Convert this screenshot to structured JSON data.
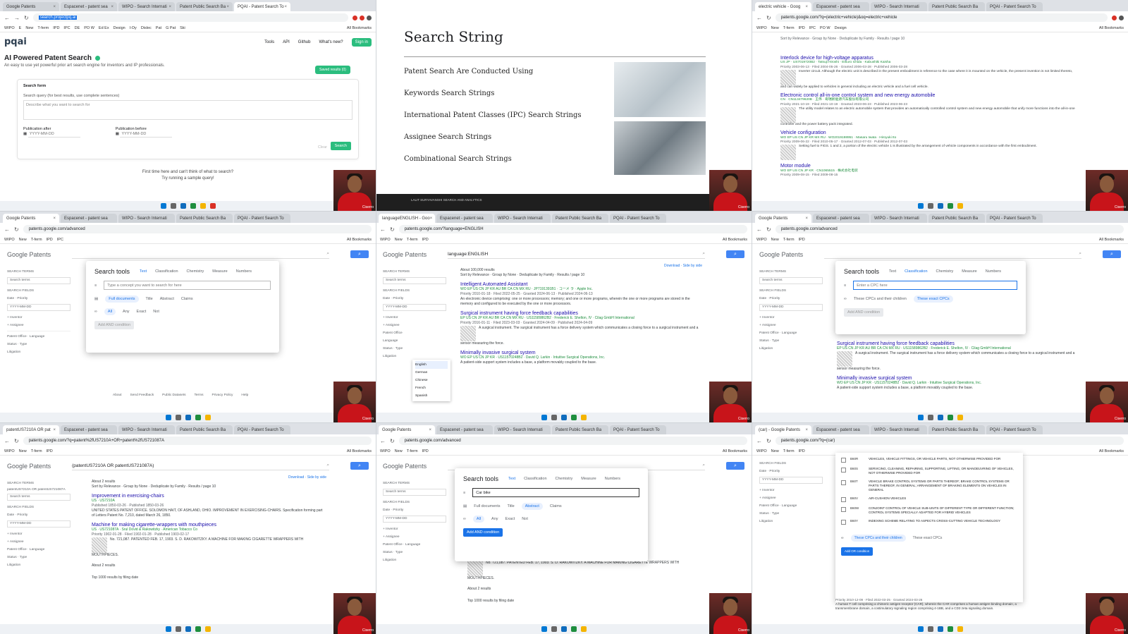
{
  "tabs": [
    "Google Patents",
    "Espacenet - patent sea",
    "WIPO - Search Internati",
    "Patent Public Search Ba",
    "PQAI - Patent Search To"
  ],
  "tabs_alt": [
    "languageENGLISH - Goo",
    "Espacenet - patent sea",
    "WIPO - Search Internati",
    "Patent Public Search Ba",
    "PQAI - Patent Search To"
  ],
  "tabs_tr": [
    "electric vehicle - Goog",
    "Espacenet - patent sea",
    "WIPO - Search Internati",
    "Patent Public Search Ba",
    "PQAI - Patent Search To"
  ],
  "tabs_bl": [
    "patentUS7210A OR pat",
    "Espacenet - patent sea",
    "WIPO - Search Internati",
    "Patent Public Search Ba",
    "PQAI - Patent Search To"
  ],
  "tabs_br": [
    "(car) - Google Patents",
    "Espacenet - patent sea",
    "WIPO - Search Internati",
    "Patent Public Search Ba",
    "PQAI - Patent Search To"
  ],
  "bookmarks": [
    "WIPO",
    "E",
    "New",
    "T-ferm",
    "IPD",
    "IPC",
    "DE",
    "PO W",
    "Ed Ex",
    "Design",
    "I-Dy",
    "Dislec",
    "Pat",
    "G Pat",
    "Ski",
    "All Bookmarks"
  ],
  "urls": {
    "pqai": "search.projectpq.ai",
    "tr": "patents.google.com/?q=(electric+vehicle)&oq=electric+vehicle",
    "advanced": "patents.google.com/advanced",
    "lang": "patents.google.com/?language=ENGLISH",
    "bl": "patents.google.com/?q=patent%2fUS7210A+OR+patent%2fUS721087A",
    "br": "patents.google.com/?q=(car)"
  },
  "pqai": {
    "logo": "pqai",
    "nav": [
      "Tools",
      "API",
      "Github",
      "What's new?"
    ],
    "sign_in": "Sign in",
    "title": "AI Powered Patent Search",
    "subtitle": "An easy to use yet powerful prior art search engine for inventors and IP professionals.",
    "saved": "Saved results (0)",
    "form_title": "Search form",
    "query_label": "Search query (for best results, use complete sentences)",
    "query_placeholder": "Describe what you want to search for",
    "after_label": "Publication after",
    "before_label": "Publication before",
    "date_placeholder": "YYYY-MM-DD",
    "clear": "Clear",
    "search": "Search",
    "foot1": "First time here and can't think of what to search?",
    "foot2": "Try running a sample query!"
  },
  "slide": {
    "title": "Search String",
    "items": [
      "Patent Search Are Conducted Using",
      "Keywords Search Strings",
      "International Patent Classes (IPC) Search Strings",
      "Assignee Search Strings",
      "Combinational Search Strings"
    ],
    "footer": "LALIT SURYAVANSHI SEARCH AND ANALYTICS"
  },
  "gp": {
    "logo_a": "Google",
    "logo_b": "Patents",
    "search_terms": "SEARCH TERMS",
    "search_terms_ph": "Search terms",
    "search_fields": "SEARCH FIELDS",
    "date": "Date",
    "priority": "Priority",
    "date_ph": "YYYY-MM-DD",
    "inventor": "+ Inventor",
    "assignee": "+ Assignee",
    "patent_office": "Patent Office",
    "language": "Language",
    "status": "Status",
    "type": "Type",
    "litigation": "Litigation",
    "download": "Download",
    "side_by_side": "Side by side",
    "sortbar": "Sort by Relevance · Group by None · Deduplicate by Family · Results / page 10",
    "footer_links": [
      "About",
      "Send Feedback",
      "Public Datasets",
      "Terms",
      "Privacy Policy",
      "Help"
    ]
  },
  "modal": {
    "title": "Search tools",
    "tabs": [
      "Text",
      "Classification",
      "Chemistry",
      "Measure",
      "Numbers"
    ],
    "concept_ph": "Type a concept you want to search for here",
    "scopes": [
      "Full documents",
      "Title",
      "Abstract",
      "Claims"
    ],
    "logic": [
      "All",
      "Any",
      "Exact",
      "Not"
    ],
    "add_and": "Add AND condition",
    "add_or": "Add OR condition",
    "cpc_ph": "Enter a CPC here",
    "cpc_children": "These CPCs and their children",
    "cpc_exact": "These exact CPCs",
    "car_value": "Car bike"
  },
  "tr_results": [
    {
      "title": "Interlock device for high-voltage apparatus",
      "meta": "US JP · US7019720B2 · Tatsuji Hiroshi · Etsuro Ichida · Kabushiki Kaisha",
      "dates": "Priority 2003-06-13 · Filed 2004-05-26 · Granted 2006-03-28 · Published 2006-03-28",
      "snippet": "Inverter circuit. Although the electric unit is described in the present embodiment in reference to the case where it is mounted on the vehicle, the present invention is not limited thereto, and can widely be applied to vehicles in general including an electric vehicle and a fuel cell vehicle."
    },
    {
      "title": "Electronic control all-in-one control system and new energy automobile",
      "meta": "CN · CN113479620B · 王伟 · 奇瑞新能源汽车股份有限公司",
      "dates": "Priority 2021-10-19 · Filed 2021-10-19 · Granted 2023-06-23 · Published 2023-06-23",
      "snippet": "The utility model relates to an electric automobile system that provides an automatically controlled control system and new energy automobile that unify more functions into the all-in-one controller and the power battery pack integrated."
    },
    {
      "title": "Vehicle configuration",
      "meta": "WO EP US CN JP KR MX RU · WO2019198951 · Masaru Iwata · Hiroyuki Ito",
      "dates": "Priority 2009-06-22 · Filed 2010-05-17 · Granted 2012-07-03 · Published 2012-07-03",
      "snippet": "Setting fuel to FIGS. 1 and 2, a portion of the electric vehicle 1 is illustrated by the arrangement of vehicle components in accordance with the first embodiment."
    },
    {
      "title": "Motor module",
      "meta": "WO EP US CN JP KR · CN1065515 · 株式会社电装",
      "dates": "Priority 2009-08-15 · Filed 2009-08-15",
      "snippet": ""
    }
  ],
  "lang_results": {
    "count": "About 100,000 results",
    "items": [
      {
        "title": "Intelligent Automated Assistant",
        "meta": "WO EP US CN JP KR AU BR CA CN MX RU · JP7191391B1 · コーメ ラ · Apple Inc.",
        "dates": "Priority 2010-01-18 · Filed 2022-05-25 · Granted 2024-06-13 · Published 2024-06-13",
        "snippet": "An electronic device comprising: one or more processors; memory; and one or more programs, wherein the one or more programs are stored in the memory and configured to be executed by the one or more processors."
      },
      {
        "title": "Surgical instrument having force feedback capabilities",
        "meta": "EP US CN JP KR AU BR CA CN MX RU · US11589862B2 · Frederick E. Shelton, IV · Cilag GmbH International",
        "dates": "Priority 2016-01-11 · Filed 2023-03-03 · Granted 2024-04-09 · Published 2024-04-09",
        "snippet": "A surgical instrument. The surgical instrument has a force delivery system which communicates a closing force to a surgical instrument and a sensor measuring the force."
      },
      {
        "title": "Minimally invasive surgical system",
        "meta": "WO EP US CN JP KR · US11570248B2 · David Q. Larkin · Intuitive Surgical Operations, Inc.",
        "dates": "",
        "snippet": "A patient-side support system includes a base, a platform movably coupled to the base."
      }
    ],
    "languages": [
      "English",
      "German",
      "Chinese",
      "French",
      "Spanish"
    ]
  },
  "bl_results": {
    "query": "(patentUS7210A OR patentUS721087A)",
    "count": "About 2 results",
    "terms": "patentUS7210A OR patentUS721087A",
    "items": [
      {
        "title": "Improvement in exercising-chairs",
        "meta": "US · US7210A",
        "dates": "Published 1850-03-26 · Published 1850-03-26",
        "snippet": "UNITED STATES PATENT OFFICE. SOLOMON HAIT, OF ASHLAND, OHIO. IMPROVEMENT IN EXERCISING-CHAIRS. Specification forming part of Letters Patent No. 7,210, dated March 26, 1850."
      },
      {
        "title": "Machine for making cigarette-wrappers with mouthpieces",
        "meta": "US · US721087A · Srul Dovid & Rakowitzky · American Tobacco Co",
        "dates": "Priority 1902-01-28 · Filed 1902-01-28 · Published 1903-02-17",
        "snippet": "No. 721,087. PATENTED FEB. 17, 1903. S. D. RAKOWITZKY. A MACHINE FOR MAKING CIGARETTE WRAPPERS WITH MOUTHPIECES."
      }
    ],
    "footer": "Top 1000 results by filing date"
  },
  "cpc_list": [
    {
      "code": "B60R",
      "text": "VEHICLES, VEHICLE FITTINGS, OR VEHICLE PARTS, NOT OTHERWISE PROVIDED FOR"
    },
    {
      "code": "B60S",
      "text": "SERVICING, CLEANING, REPAIRING, SUPPORTING, LIFTING, OR MANOEUVRING OF VEHICLES, NOT OTHERWISE PROVIDED FOR"
    },
    {
      "code": "B60T",
      "text": "VEHICLE BRAKE CONTROL SYSTEMS OR PARTS THEREOF; BRAKE CONTROL SYSTEMS OR PARTS THEREOF, IN GENERAL; ARRANGEMENT OF BRAKING ELEMENTS ON VEHICLES IN GENERAL"
    },
    {
      "code": "B60V",
      "text": "AIR-CUSHION VEHICLES"
    },
    {
      "code": "B60W",
      "text": "CONJOINT CONTROL OF VEHICLE SUB-UNITS OF DIFFERENT TYPE OR DIFFERENT FUNCTION; CONTROL SYSTEMS SPECIALLY ADAPTED FOR HYBRID VEHICLES"
    },
    {
      "code": "B60Y",
      "text": "INDEXING SCHEME RELATING TO ASPECTS CROSS-CUTTING VEHICLE TECHNOLOGY"
    }
  ],
  "br_snippet": {
    "dates": "Priority 2010-12-09 · Filed 2022-03-25 · Granted 2024-03-26",
    "text": "A human T cell comprising a chimeric antigen receptor (CAR), wherein the CAR comprises a human antigen binding domain, a transmembrane domain, a costimulatory signaling region comprising 4-1BB, and a CD3 zeta signaling domain."
  },
  "cam_label": "Ciserro",
  "colors": {
    "accent_green": "#2bbd7e",
    "google_blue": "#4285f4",
    "link": "#1a0dab",
    "cam_red": "#c8141a"
  }
}
